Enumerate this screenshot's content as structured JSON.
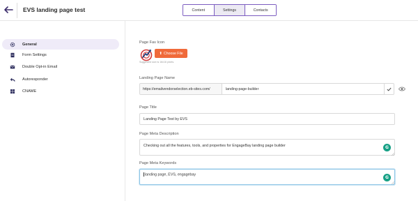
{
  "header": {
    "title": "EVS landing page test",
    "tabs": [
      {
        "label": "Content",
        "active": false
      },
      {
        "label": "Settings",
        "active": true
      },
      {
        "label": "Contacts",
        "active": false
      }
    ]
  },
  "sidebar": {
    "items": [
      {
        "label": "General",
        "icon": "gear-icon",
        "active": true
      },
      {
        "label": "Form Settings",
        "icon": "document-icon",
        "active": false
      },
      {
        "label": "Double Opt-in Email",
        "icon": "mail-icon",
        "active": false
      },
      {
        "label": "Autoresponder",
        "icon": "reply-icon",
        "active": false
      },
      {
        "label": "CNAME",
        "icon": "grid-icon",
        "active": false
      }
    ]
  },
  "main": {
    "favicon": {
      "label": "Page Fav Icon",
      "button_label": "Choose File",
      "note": "Suggested size is 16x16 pixels."
    },
    "landing_page_name": {
      "label": "Landing Page Name",
      "prefix": "https://emailvendorselection.eb-sites.com/",
      "value": "landing-page-builder"
    },
    "page_title": {
      "label": "Page Title",
      "value": "Landing Page Test by EVS"
    },
    "meta_description": {
      "label": "Page Meta Description",
      "value": "Checking out all the features, tools, and properties for EngageBay landing page builder"
    },
    "meta_keywords": {
      "label": "Page Meta Keywords",
      "value": "landing page, EVS, engagebay"
    }
  },
  "colors": {
    "accent": "#7b5cc0",
    "button": "#f06a3a",
    "grammarly": "#16a085",
    "sidebar_active": "#efebf8"
  }
}
